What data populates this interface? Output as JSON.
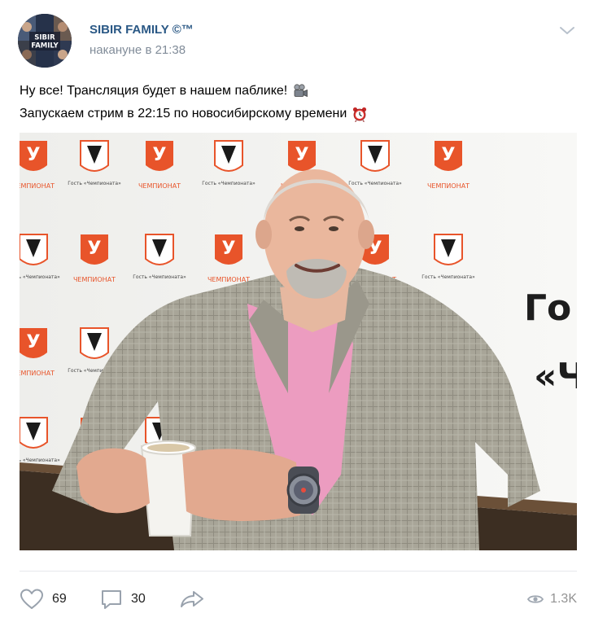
{
  "post": {
    "author": "SIBIR FAMILY ©™",
    "timestamp": "накануне в 21:38",
    "avatar_text_1": "SIBIR",
    "avatar_text_2": "FAMILY",
    "text_line_1": "Ну все! Трансляция будет в нашем паблике!",
    "text_line_2": "Запускаем стрим в 22:15 по новосибирскому времени",
    "emoji_1": "movie-camera-icon",
    "emoji_2": "alarm-clock-icon"
  },
  "photo": {
    "backdrop_brand": "ЧЕМПИОНАТ",
    "backdrop_partner": "Гость «Чемпионата»",
    "backdrop_big_text_1": "Го",
    "backdrop_big_text_2": "«Ч"
  },
  "actions": {
    "likes": "69",
    "comments": "30",
    "views": "1.3K",
    "like_icon": "heart-icon",
    "comment_icon": "comment-icon",
    "share_icon": "share-icon",
    "views_icon": "eye-icon"
  },
  "colors": {
    "brand_orange": "#e8542a",
    "link_blue": "#2a5885",
    "muted_gray": "#818c99"
  }
}
